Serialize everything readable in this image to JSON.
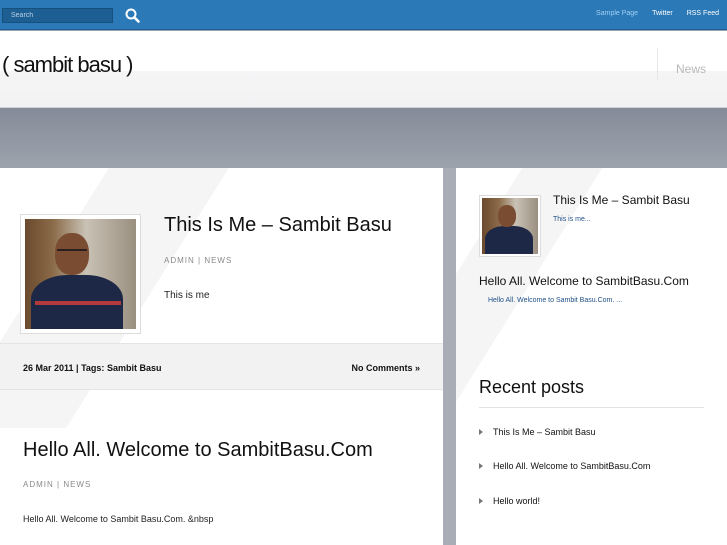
{
  "topbar": {
    "search_placeholder": "Search",
    "links": [
      {
        "label": "Sample Page",
        "active": true
      },
      {
        "label": "Twitter",
        "active": false
      },
      {
        "label": "RSS Feed",
        "active": false
      }
    ]
  },
  "header": {
    "site_title": "( sambit basu )",
    "nav": [
      "News"
    ]
  },
  "posts": [
    {
      "title": "This Is Me – Sambit Basu",
      "author": "ADMIN",
      "category": "NEWS",
      "excerpt": "This is me",
      "date": "26 Mar 2011",
      "tags_label": "Tags:",
      "tags": "Sambit Basu",
      "comments": "No Comments »"
    },
    {
      "title": "Hello All. Welcome to SambitBasu.Com",
      "author": "ADMIN",
      "category": "NEWS",
      "excerpt": "Hello All. Welcome to Sambit Basu.Com. &nbsp"
    }
  ],
  "sidebar": {
    "featured": [
      {
        "title": "This Is Me – Sambit Basu",
        "excerpt": "This is me..."
      },
      {
        "title": "Hello All. Welcome to SambitBasu.Com",
        "excerpt": "Hello All. Welcome to Sambit Basu.Com. ..."
      }
    ],
    "recent_heading": "Recent posts",
    "recent": [
      "This Is Me – Sambit Basu",
      "Hello All. Welcome to SambitBasu.Com",
      "Hello world!"
    ]
  },
  "colors": {
    "topbar": "#2b79b7",
    "active_link": "#9fd0f5",
    "band": "#8f96a2",
    "excerpt_link": "#1f4f86"
  },
  "icons": {
    "search": "search-icon",
    "recent_bullet": "triangle-right-icon"
  }
}
